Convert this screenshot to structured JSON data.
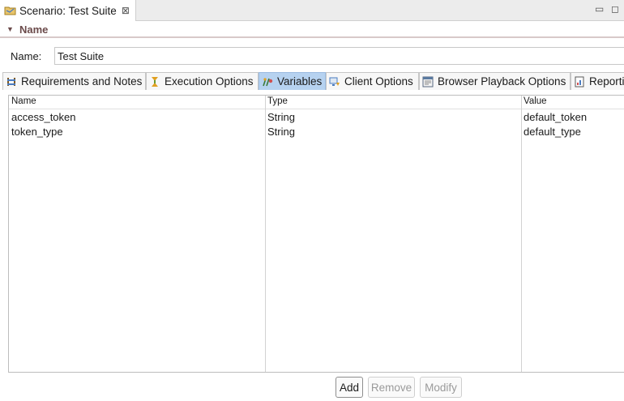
{
  "editor": {
    "tab_title": "Scenario: Test Suite",
    "close_glyph": "⊠",
    "minimize_glyph": "▭",
    "maximize_glyph": "◻"
  },
  "section": {
    "title": "Name",
    "twisty": "▼"
  },
  "name_field": {
    "label": "Name:",
    "value": "Test Suite"
  },
  "tabs": [
    {
      "label": "Requirements and Notes",
      "icon": "requirements-icon"
    },
    {
      "label": "Execution Options",
      "icon": "execution-icon"
    },
    {
      "label": "Variables",
      "icon": "variables-icon",
      "active": true
    },
    {
      "label": "Client Options",
      "icon": "client-icon"
    },
    {
      "label": "Browser Playback Options",
      "icon": "browser-icon"
    },
    {
      "label": "Reporti",
      "icon": "report-icon"
    }
  ],
  "table": {
    "columns": [
      "Name",
      "Type",
      "Value"
    ],
    "rows": [
      {
        "name": "access_token",
        "type": "String",
        "value": "default_token"
      },
      {
        "name": "token_type",
        "type": "String",
        "value": "default_type"
      }
    ]
  },
  "buttons": {
    "add": "Add",
    "remove": "Remove",
    "modify": "Modify"
  },
  "colors": {
    "active_tab": "#b6d2f0",
    "section_title": "#6b4a4a"
  }
}
